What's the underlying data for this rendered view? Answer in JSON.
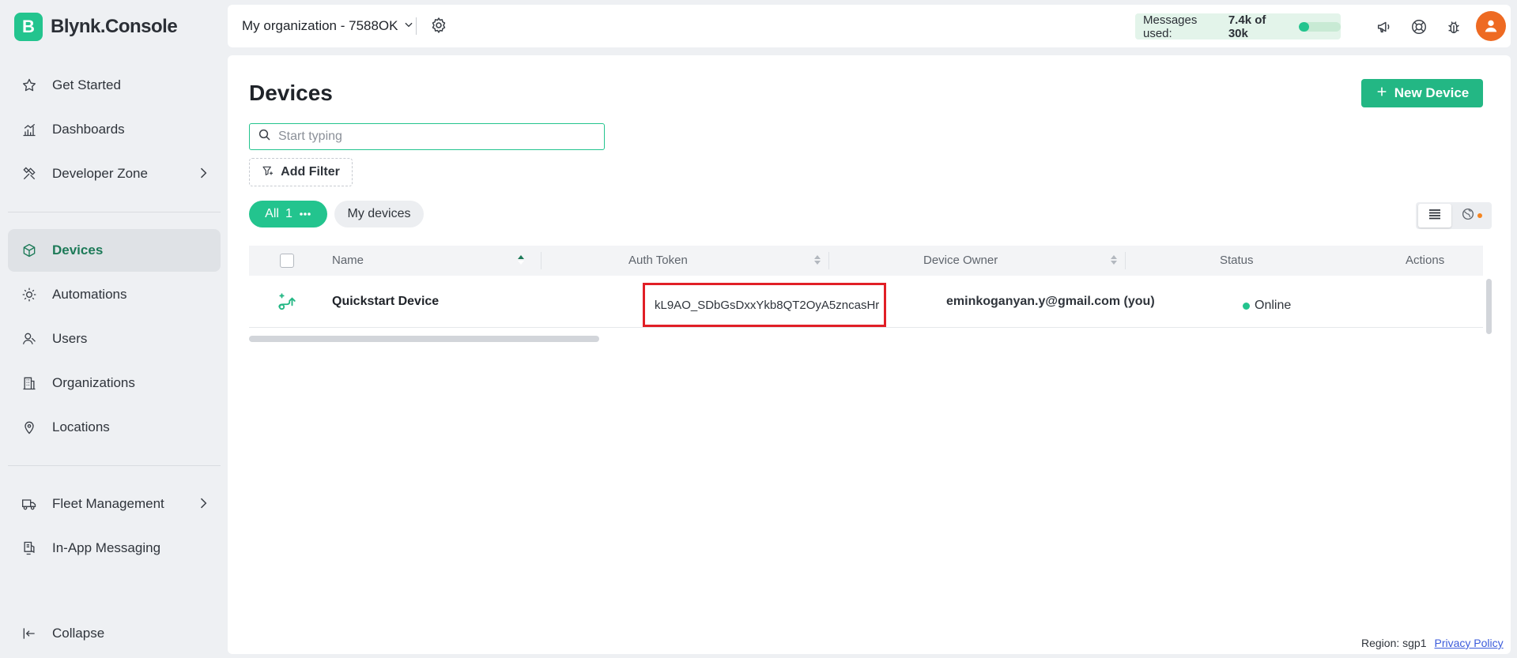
{
  "app": {
    "logo_letter": "B",
    "name": "Blynk.Console"
  },
  "sidebar": {
    "items": [
      {
        "label": "Get Started",
        "icon": "star-icon"
      },
      {
        "label": "Dashboards",
        "icon": "bar-chart-icon"
      },
      {
        "label": "Developer Zone",
        "icon": "tools-icon"
      },
      {
        "label": "Devices",
        "icon": "cube-icon",
        "active": true
      },
      {
        "label": "Automations",
        "icon": "sun-gear-icon"
      },
      {
        "label": "Users",
        "icon": "user-icon"
      },
      {
        "label": "Organizations",
        "icon": "building-icon"
      },
      {
        "label": "Locations",
        "icon": "pin-icon"
      },
      {
        "label": "Fleet Management",
        "icon": "truck-icon"
      },
      {
        "label": "In-App Messaging",
        "icon": "message-icon"
      }
    ],
    "collapse_label": "Collapse"
  },
  "topbar": {
    "org_name": "My organization - 7588OK",
    "messages_prefix": "Messages used:",
    "messages_value": "7.4k of 30k",
    "messages_fraction": 0.25
  },
  "main": {
    "title": "Devices",
    "new_device_label": "New Device",
    "search_placeholder": "Start typing",
    "add_filter_label": "Add Filter",
    "chip_all_label": "All",
    "chip_all_count": "1",
    "chip_my_label": "My devices"
  },
  "table": {
    "columns": [
      "Name",
      "Auth Token",
      "Device Owner",
      "Status",
      "Actions"
    ],
    "rows": [
      {
        "name": "Quickstart Device",
        "auth_token": "kL9AO_SDbGsDxxYkb8QT2OyA5zncasHr",
        "owner": "eminkoganyan.y@gmail.com (you)",
        "status": "Online"
      }
    ]
  },
  "footer": {
    "region": "Region: sgp1",
    "privacy": "Privacy Policy"
  },
  "colors": {
    "accent": "#23c48e",
    "highlight": "#e11f26",
    "avatar": "#ee6a22"
  }
}
